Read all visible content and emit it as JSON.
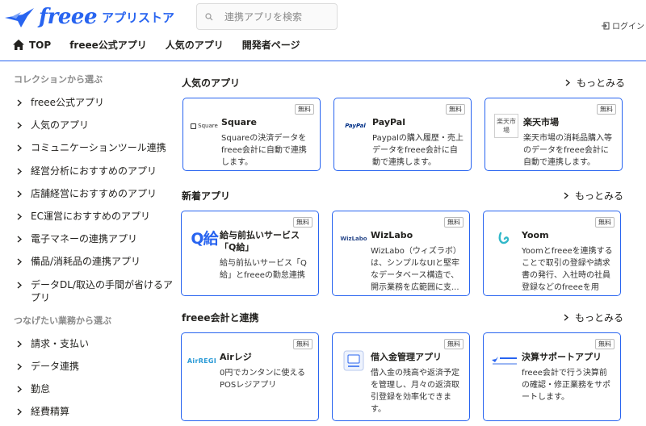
{
  "header": {
    "logo_text": "freee",
    "logo_subtitle": "アプリストア",
    "search_placeholder": "連携アプリを検索",
    "login_label": "ログイン"
  },
  "nav": {
    "items": [
      {
        "label": "TOP",
        "icon": "home-icon"
      },
      {
        "label": "freee公式アプリ"
      },
      {
        "label": "人気のアプリ"
      },
      {
        "label": "開発者ページ"
      }
    ]
  },
  "sidebar": {
    "collections_heading": "コレクションから選ぶ",
    "collections": [
      "freee公式アプリ",
      "人気のアプリ",
      "コミュニケーションツール連携",
      "経営分析におすすめのアプリ",
      "店舗経営におすすめのアプリ",
      "EC運営におすすめのアプリ",
      "電子マネーの連携アプリ",
      "備品/消耗品の連携アプリ",
      "データDL/取込の手間が省けるアプリ"
    ],
    "tasks_heading": "つなげたい業務から選ぶ",
    "tasks": [
      "請求・支払い",
      "データ連携",
      "勤怠",
      "経費精算"
    ]
  },
  "sections": [
    {
      "title": "人気のアプリ",
      "more_label": "もっとみる",
      "cards": [
        {
          "name": "Square",
          "badge": "無料",
          "logo_text": "Square",
          "logo_type": "square",
          "description": "Squareの決済データをfreee会計に自動で連携します。"
        },
        {
          "name": "PayPal",
          "badge": "無料",
          "logo_text": "PayPal",
          "logo_type": "paypal",
          "description": "Paypalの購入履歴・売上データをfreee会計に自動で連携します。"
        },
        {
          "name": "楽天市場",
          "badge": "無料",
          "logo_text": "楽天市場",
          "logo_type": "rakuten",
          "description": "楽天市場の消耗品購入等のデータをfreee会計に自動で連携します。"
        }
      ]
    },
    {
      "title": "新着アプリ",
      "more_label": "もっとみる",
      "cards": [
        {
          "name": "給与前払いサービス「Q給」",
          "badge": "無料",
          "logo_text": "Q給",
          "logo_type": "q",
          "description": "給与前払いサービス「Q給」とfreeeの勤怠連携"
        },
        {
          "name": "WizLabo",
          "badge": "無料",
          "logo_text": "WizLabo",
          "logo_type": "wiz",
          "description": "WizLabo（ウィズラボ）は、シンプルなUIと堅牢なデータベース構造で、開示業務を広範囲に支..."
        },
        {
          "name": "Yoom",
          "badge": "無料",
          "logo_text": "",
          "logo_type": "yoom",
          "description": "Yoomとfreeeを連携することで取引の登録や請求書の発行、入社時の社員登録などのfreeeを用い..."
        }
      ]
    },
    {
      "title": "freee会計と連携",
      "more_label": "もっとみる",
      "cards": [
        {
          "name": "Airレジ",
          "badge": "無料",
          "logo_text": "AirREGI",
          "logo_type": "airregi",
          "description": "0円でカンタンに使えるPOSレジアプリ"
        },
        {
          "name": "借入金管理アプリ",
          "badge": "無料",
          "logo_text": "",
          "logo_type": "loan",
          "description": "借入金の残高や返済予定を管理し、月々の返済取引登録を効率化できます。"
        },
        {
          "name": "決算サポートアプリ",
          "badge": "無料",
          "logo_text": "",
          "logo_type": "kessan",
          "description": "freee会計で行う決算前の確認・修正業務をサポートします。"
        }
      ]
    }
  ],
  "colors": {
    "brand_blue": "#2864f0",
    "text_dark": "#23221f",
    "muted_gray": "#8a8a8a"
  }
}
